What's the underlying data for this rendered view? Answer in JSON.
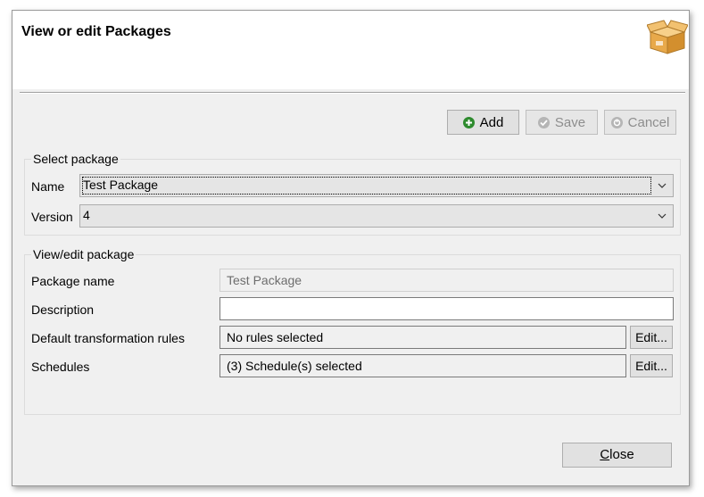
{
  "window": {
    "title": "View or edit Packages",
    "header_icon": "package-box-icon"
  },
  "toolbar": {
    "add_label": "Add",
    "save_label": "Save",
    "cancel_label": "Cancel",
    "add_icon": "plus-circle-icon",
    "save_icon": "check-circle-icon",
    "cancel_icon": "cancel-circle-icon"
  },
  "select_package": {
    "legend": "Select package",
    "name_label": "Name",
    "name_value": "Test Package",
    "version_label": "Version",
    "version_value": "4"
  },
  "edit_package": {
    "legend": "View/edit package",
    "package_name_label": "Package name",
    "package_name_value": "Test Package",
    "description_label": "Description",
    "description_value": "",
    "rules_label": "Default transformation rules",
    "rules_value": "No rules selected",
    "rules_edit": "Edit...",
    "schedules_label": "Schedules",
    "schedules_value": "(3) Schedule(s) selected",
    "schedules_edit": "Edit..."
  },
  "footer": {
    "close_first": "C",
    "close_rest": "lose"
  },
  "colors": {
    "add_icon": "#2e8b2e",
    "disabled_icon": "#a8a8a8",
    "dialog_bg": "#f0f0f0"
  }
}
